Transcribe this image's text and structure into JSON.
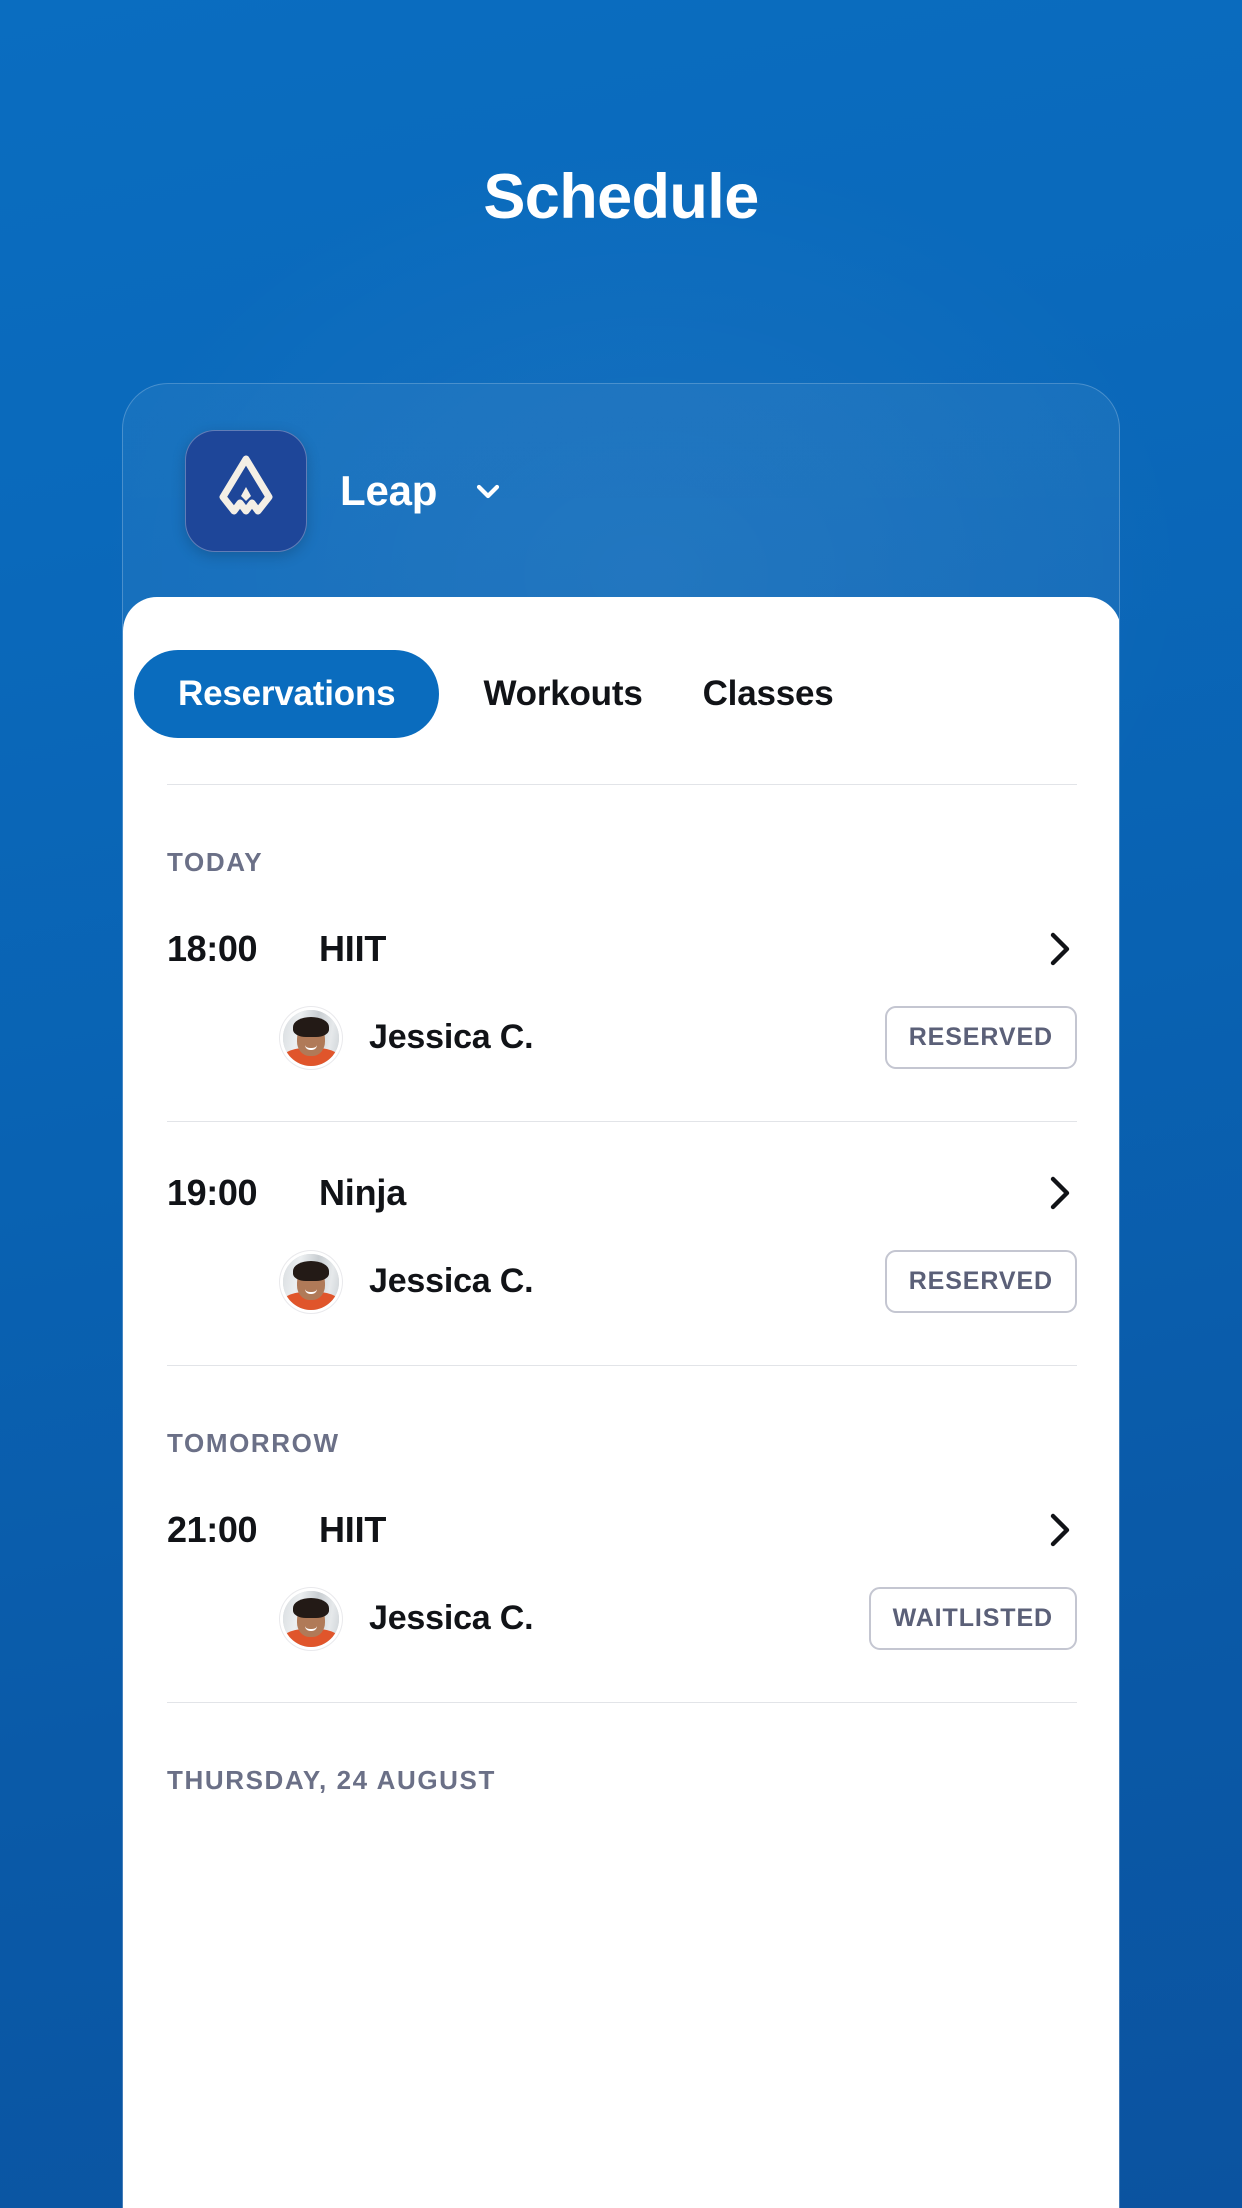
{
  "header": {
    "title": "Schedule"
  },
  "org": {
    "name": "Leap",
    "logo_icon": "leap-mountain-logo",
    "chevron_icon": "chevron-down-icon"
  },
  "tabs": [
    {
      "label": "Reservations",
      "active": true
    },
    {
      "label": "Workouts",
      "active": false
    },
    {
      "label": "Classes",
      "active": false
    }
  ],
  "groups": [
    {
      "day_label": "TODAY",
      "entries": [
        {
          "time": "18:00",
          "class_name": "HIIT",
          "chevron_icon": "chevron-right-icon",
          "attendee": {
            "name": "Jessica C.",
            "avatar_icon": "user-avatar-photo",
            "status": "RESERVED"
          }
        },
        {
          "time": "19:00",
          "class_name": "Ninja",
          "chevron_icon": "chevron-right-icon",
          "attendee": {
            "name": "Jessica C.",
            "avatar_icon": "user-avatar-photo",
            "status": "RESERVED"
          }
        }
      ]
    },
    {
      "day_label": "TOMORROW",
      "entries": [
        {
          "time": "21:00",
          "class_name": "HIIT",
          "chevron_icon": "chevron-right-icon",
          "attendee": {
            "name": "Jessica C.",
            "avatar_icon": "user-avatar-photo",
            "status": "WAITLISTED"
          }
        }
      ]
    },
    {
      "day_label": "THURSDAY, 24 AUGUST",
      "entries": []
    }
  ],
  "colors": {
    "background_blue": "#0a6cbe",
    "background_blue_deep": "#0b53a0",
    "accent": "#0a6cbe",
    "logo_badge": "#1e4699",
    "text_primary": "#111317",
    "text_muted": "#6b7087",
    "badge_border": "#c4c6d1",
    "badge_text": "#5b6078",
    "divider": "#e2e4e8",
    "sheet": "#ffffff"
  }
}
